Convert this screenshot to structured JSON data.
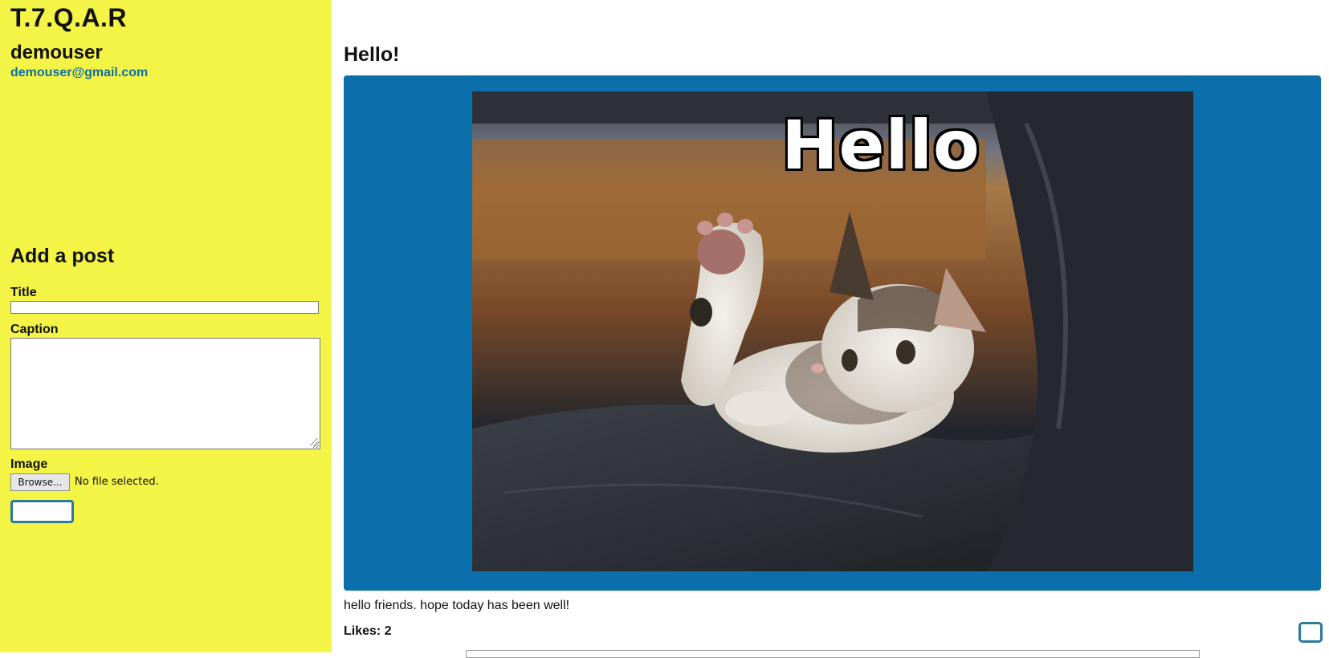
{
  "sidebar": {
    "brand": "T.7.Q.A.R",
    "username": "demouser",
    "email": "demouser@gmail.com",
    "bg_color": "#f4f447"
  },
  "add_post": {
    "heading": "Add a post",
    "title_label": "Title",
    "title_value": "",
    "caption_label": "Caption",
    "caption_value": "",
    "image_label": "Image",
    "browse_label": "Browse...",
    "file_status": "No file selected.",
    "submit_label": ""
  },
  "post": {
    "title": "Hello!",
    "image_text": "Hello",
    "caption": "hello friends. hope today has been well!",
    "likes_text": "Likes: 2",
    "frame_color": "#0a6fab"
  }
}
